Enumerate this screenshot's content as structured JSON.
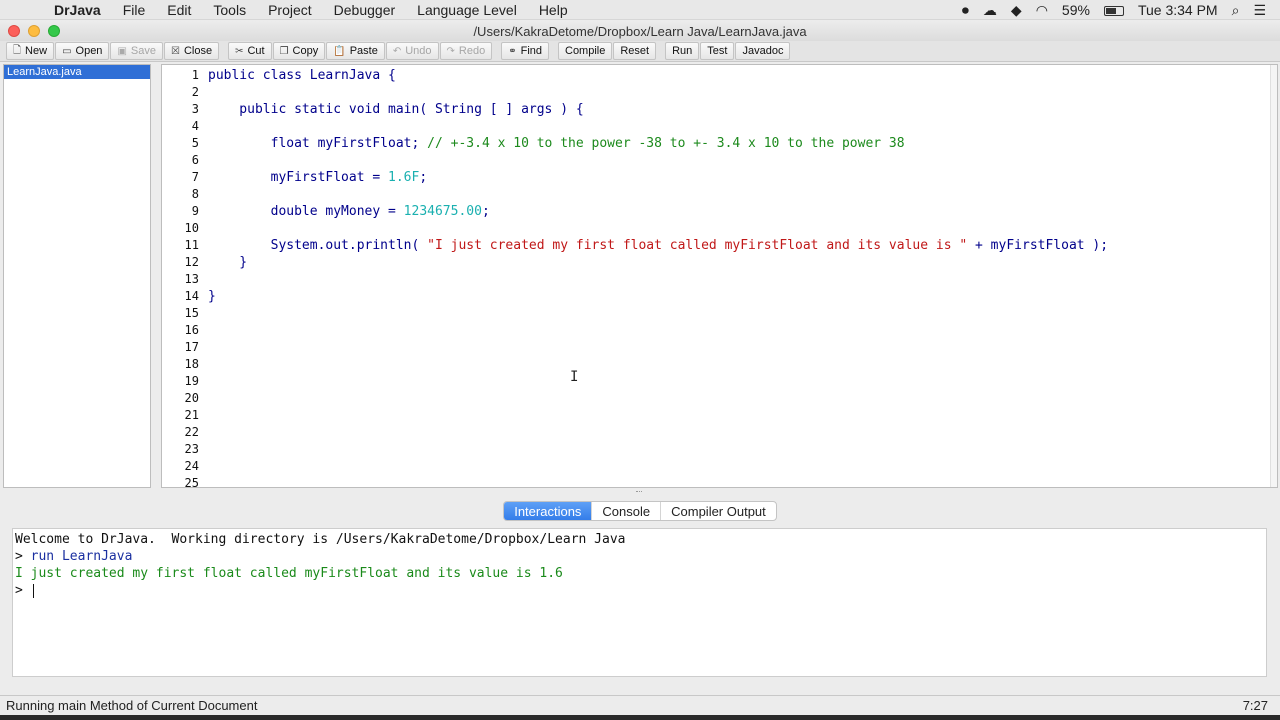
{
  "menubar": {
    "app": "DrJava",
    "items": [
      "File",
      "Edit",
      "Tools",
      "Project",
      "Debugger",
      "Language Level",
      "Help"
    ],
    "battery": "59%",
    "clock": "Tue 3:34 PM"
  },
  "window": {
    "title": "/Users/KakraDetome/Dropbox/Learn Java/LearnJava.java"
  },
  "toolbar": {
    "new": "New",
    "open": "Open",
    "save": "Save",
    "close": "Close",
    "cut": "Cut",
    "copy": "Copy",
    "paste": "Paste",
    "undo": "Undo",
    "redo": "Redo",
    "find": "Find",
    "compile": "Compile",
    "reset": "Reset",
    "run": "Run",
    "test": "Test",
    "javadoc": "Javadoc"
  },
  "files": [
    "LearnJava.java"
  ],
  "editor": {
    "line_numbers": [
      "1",
      "2",
      "3",
      "4",
      "5",
      "6",
      "7",
      "8",
      "9",
      "10",
      "11",
      "12",
      "13",
      "14",
      "15",
      "16",
      "17",
      "18",
      "19",
      "20",
      "21",
      "22",
      "23",
      "24",
      "25"
    ],
    "l1": "public class LearnJava {",
    "l3": "    public static void main( String [ ] args ) {",
    "l5_code": "        float myFirstFloat; ",
    "l5_comment": "// +-3.4 x 10 to the power -38 to +- 3.4 x 10 to the power 38",
    "l7_a": "        myFirstFloat = ",
    "l7_num": "1.6F",
    "l7_b": ";",
    "l9_a": "        double myMoney = ",
    "l9_num": "1234675.00",
    "l9_b": ";",
    "l11_a": "        System.out.println( ",
    "l11_str": "\"I just created my first float called myFirstFloat and its value is \"",
    "l11_b": " + myFirstFloat );",
    "l12": "    }",
    "l14": "}"
  },
  "tabs": {
    "interactions": "Interactions",
    "console": "Console",
    "compiler": "Compiler Output"
  },
  "interactions": {
    "welcome": "Welcome to DrJava.  Working directory is /Users/KakraDetome/Dropbox/Learn Java",
    "prompt1": "> ",
    "cmd": "run LearnJava",
    "output": "I just created my first float called myFirstFloat and its value is 1.6",
    "prompt2": "> "
  },
  "status": {
    "text": "Running main Method of Current Document",
    "position": "7:27"
  },
  "colors": {
    "keyword": "#00008b",
    "comment": "#1d8a1d",
    "number": "#1ab0b0",
    "string": "#c01818",
    "selection": "#2f6fd6"
  }
}
